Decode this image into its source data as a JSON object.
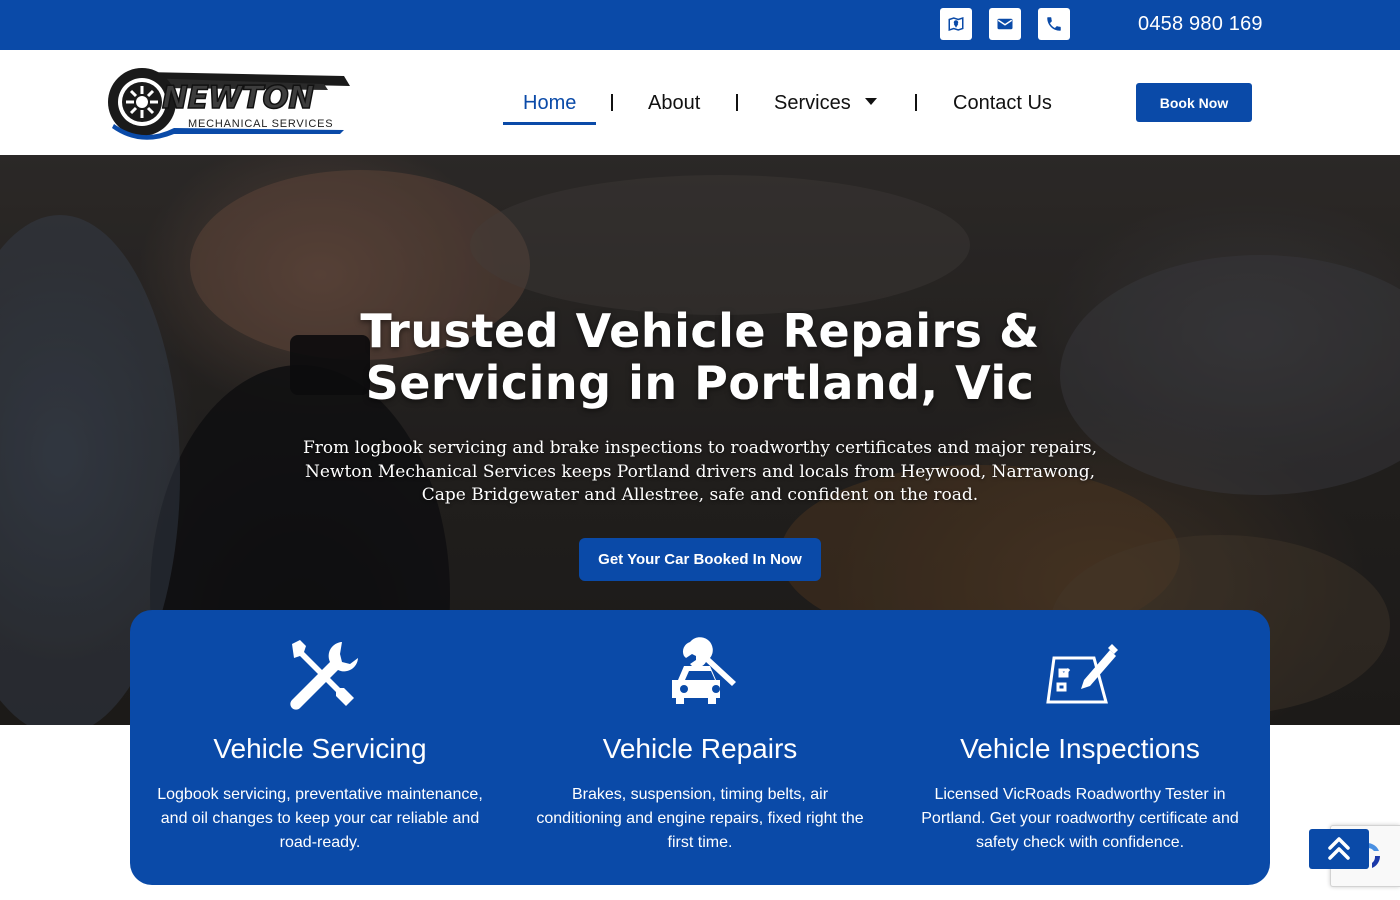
{
  "topbar": {
    "phone": "0458 980 169",
    "icons": [
      "map-icon",
      "envelope-icon",
      "phone-icon"
    ]
  },
  "logo": {
    "name": "NEWTON",
    "tagline": "MECHANICAL SERVICES"
  },
  "nav": {
    "items": [
      {
        "label": "Home",
        "active": true
      },
      {
        "label": "About",
        "active": false
      },
      {
        "label": "Services",
        "active": false,
        "dropdown": true
      },
      {
        "label": "Contact Us",
        "active": false
      }
    ],
    "cta": "Book Now"
  },
  "hero": {
    "title_line1": "Trusted Vehicle Repairs &",
    "title_line2": "Servicing in Portland, Vic",
    "subtitle_line1": "From logbook servicing and brake inspections to roadworthy certificates and major repairs,",
    "subtitle_line2": "Newton Mechanical Services keeps Portland drivers and locals from Heywood, Narrawong,",
    "subtitle_line3": "Cape Bridgewater and Allestree, safe and confident on the road.",
    "button": "Get Your Car Booked In Now"
  },
  "services": [
    {
      "icon": "tools-icon",
      "title": "Vehicle Servicing",
      "desc_line1": "Logbook servicing, preventative maintenance,",
      "desc_line2": "and oil changes to keep your car reliable and",
      "desc_line3": "road-ready."
    },
    {
      "icon": "car-wrench-icon",
      "title": "Vehicle Repairs",
      "desc_line1": "Brakes, suspension, timing belts, air",
      "desc_line2": "conditioning and engine repairs, fixed right the",
      "desc_line3": "first time."
    },
    {
      "icon": "checklist-pen-icon",
      "title": "Vehicle Inspections",
      "desc_line1": "Licensed VicRoads Roadworthy Tester in",
      "desc_line2": "Portland. Get your roadworthy certificate and",
      "desc_line3": "safety check with confidence."
    }
  ],
  "colors": {
    "brand_blue": "#0a4aa8",
    "white": "#ffffff",
    "text_dark": "#111111"
  }
}
